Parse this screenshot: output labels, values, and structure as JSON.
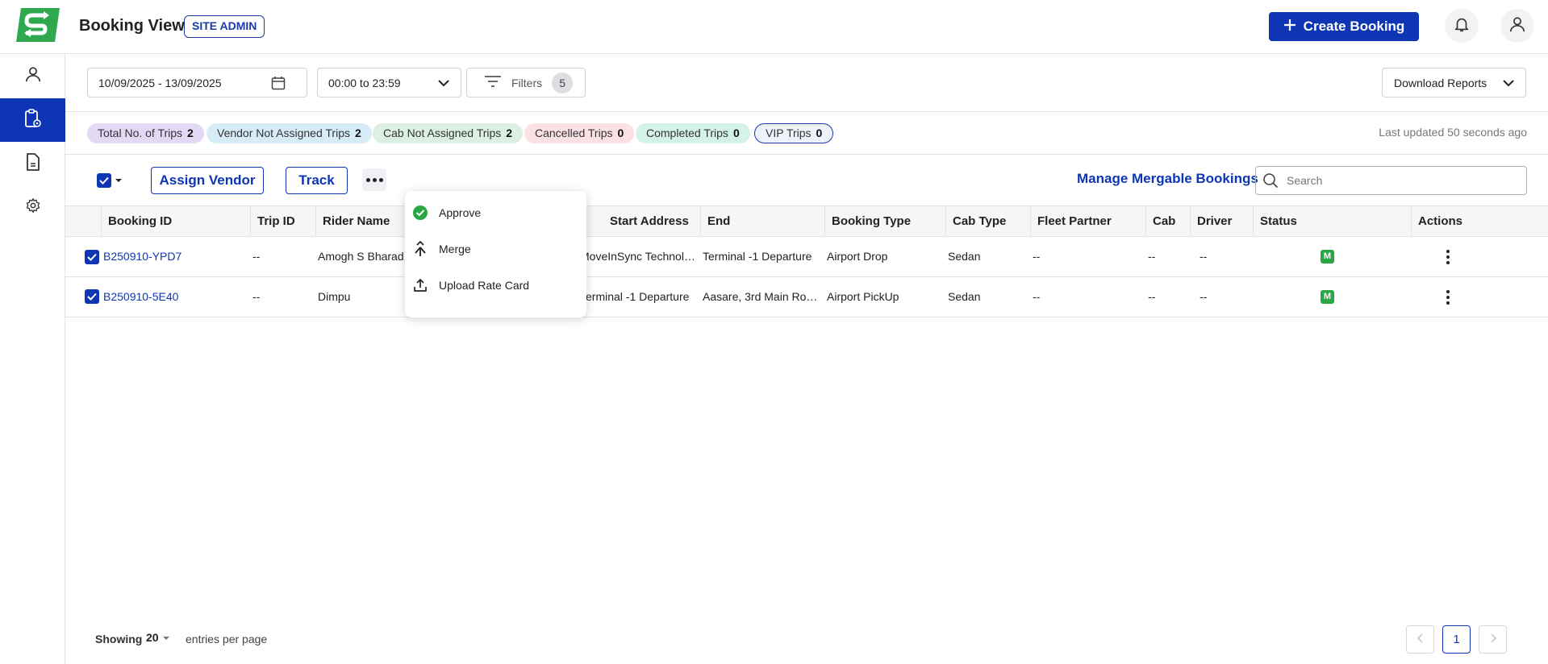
{
  "header": {
    "title": "Booking View",
    "role_badge": "SITE ADMIN",
    "create_button": "Create Booking"
  },
  "sidebar": {
    "items": [
      {
        "icon": "user-icon",
        "active": false
      },
      {
        "icon": "clipboard-view-icon",
        "active": true
      },
      {
        "icon": "document-icon",
        "active": false
      },
      {
        "icon": "gear-icon",
        "active": false
      }
    ]
  },
  "filters": {
    "date_range": "10/09/2025 - 13/09/2025",
    "time_range": "00:00 to 23:59",
    "filters_label": "Filters",
    "filters_count": "5",
    "download_label": "Download Reports"
  },
  "chips": [
    {
      "label": "Total No. of Trips",
      "count": "2",
      "color": "#e2d9f5"
    },
    {
      "label": "Vendor Not Assigned Trips",
      "count": "2",
      "color": "#d6ecf7"
    },
    {
      "label": "Cab Not Assigned Trips",
      "count": "2",
      "color": "#dcf0e2"
    },
    {
      "label": "Cancelled Trips",
      "count": "0",
      "color": "#fbe0e6"
    },
    {
      "label": "Completed Trips",
      "count": "0",
      "color": "#d3f2ea"
    },
    {
      "label": "VIP Trips",
      "count": "0",
      "color": "#eef2fb"
    }
  ],
  "last_updated": "Last updated 50 seconds ago",
  "toolbar": {
    "assign_vendor": "Assign Vendor",
    "track": "Track",
    "manage_mergable": "Manage Mergable Bookings",
    "search_placeholder": "Search"
  },
  "menu": {
    "items": [
      {
        "label": "Approve",
        "icon": "check-circle-icon"
      },
      {
        "label": "Merge",
        "icon": "merge-icon"
      },
      {
        "label": "Upload Rate Card",
        "icon": "upload-icon"
      }
    ]
  },
  "table": {
    "columns": [
      "Booking ID",
      "Trip ID",
      "Rider Name",
      "Start Address",
      "End",
      "Booking Type",
      "Cab Type",
      "Fleet Partner",
      "Cab",
      "Driver",
      "Status",
      "Actions"
    ],
    "rows": [
      {
        "booking_id": "B250910-YPD7",
        "trip_id": "--",
        "rider_name": "Amogh S Bharad...",
        "start_address": "MoveInSync Technolog...",
        "end": "Terminal -1 Departure",
        "booking_type": "Airport Drop",
        "cab_type": "Sedan",
        "fleet_partner": "--",
        "cab": "--",
        "driver": "--",
        "status": "M"
      },
      {
        "booking_id": "B250910-5E40",
        "trip_id": "--",
        "rider_name": "Dimpu",
        "start_address": "Terminal -1 Departure",
        "end": "Aasare, 3rd Main Road, ...",
        "booking_type": "Airport PickUp",
        "cab_type": "Sedan",
        "fleet_partner": "--",
        "cab": "--",
        "driver": "--",
        "status": "M"
      }
    ]
  },
  "footer": {
    "showing": "Showing",
    "per_page": "20",
    "entries_label": "entries per page",
    "current_page": "1"
  },
  "colors": {
    "primary": "#0e36b4",
    "logo_green": "#2fa84f",
    "status_green": "#29a745"
  }
}
